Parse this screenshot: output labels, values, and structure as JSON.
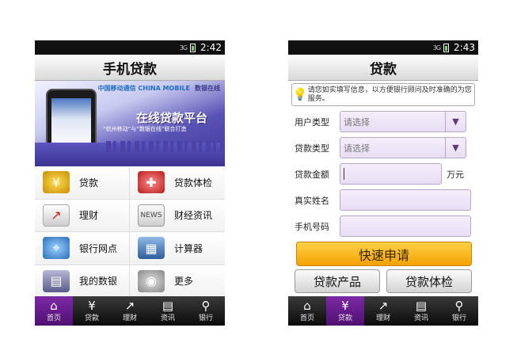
{
  "phone1": {
    "status": {
      "signal": "3G",
      "time": "2:42"
    },
    "title": "手机贷款",
    "banner": {
      "logo_cm": "中国移动通信 CHINA MOBILE",
      "logo_bank": "数银在线",
      "heading": "在线贷款平台",
      "subheading": "“杭州移动”与“数银在线”联合打造"
    },
    "menu": [
      {
        "label": "贷款",
        "icon": "yuan-coins-icon"
      },
      {
        "label": "贷款体检",
        "icon": "medical-check-icon"
      },
      {
        "label": "理财",
        "icon": "finance-chart-icon"
      },
      {
        "label": "财经资讯",
        "icon": "news-envelope-icon"
      },
      {
        "label": "银行网点",
        "icon": "map-pin-icon"
      },
      {
        "label": "计算器",
        "icon": "calculator-icon"
      },
      {
        "label": "我的数银",
        "icon": "personal-account-icon"
      },
      {
        "label": "更多",
        "icon": "more-icon"
      }
    ],
    "nav": [
      {
        "label": "首页",
        "icon": "home-icon",
        "active": true
      },
      {
        "label": "贷款",
        "icon": "yuan-icon",
        "active": false
      },
      {
        "label": "理财",
        "icon": "trend-icon",
        "active": false
      },
      {
        "label": "资讯",
        "icon": "document-icon",
        "active": false
      },
      {
        "label": "银行",
        "icon": "location-icon",
        "active": false
      }
    ]
  },
  "phone2": {
    "status": {
      "signal": "3G",
      "time": "2:43"
    },
    "title": "贷款",
    "tip": "请您如实填写信息，以方便银行顾问及时准确的为您服务。",
    "form": {
      "user_type_label": "用户类型",
      "user_type_value": "请选择",
      "loan_type_label": "贷款类型",
      "loan_type_value": "请选择",
      "amount_label": "贷款金额",
      "amount_unit": "万元",
      "name_label": "真实姓名",
      "phone_label": "手机号码"
    },
    "submit_label": "快速申请",
    "products_label": "贷款产品",
    "checkup_label": "贷款体检",
    "nav": [
      {
        "label": "首页",
        "icon": "home-icon",
        "active": false
      },
      {
        "label": "贷款",
        "icon": "yuan-icon",
        "active": true
      },
      {
        "label": "理财",
        "icon": "trend-icon",
        "active": false
      },
      {
        "label": "资讯",
        "icon": "document-icon",
        "active": false
      },
      {
        "label": "银行",
        "icon": "location-icon",
        "active": false
      }
    ]
  },
  "colors": {
    "accent_purple": "#6a1f92",
    "cta_orange": "#f6b300",
    "field_lilac": "#efe6f8"
  }
}
